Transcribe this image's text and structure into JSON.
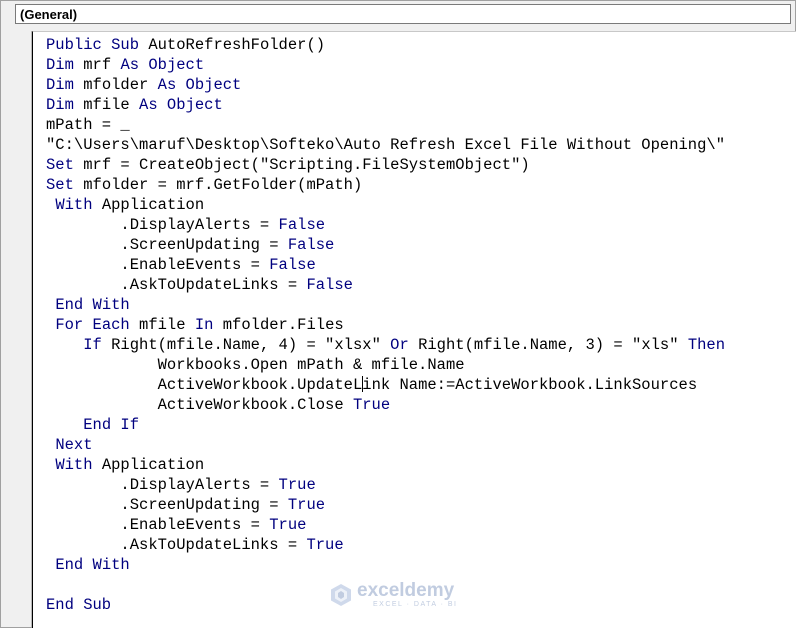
{
  "window": {
    "object_dropdown": "(General)"
  },
  "code_lines": [
    [
      {
        "k": "kw",
        "t": "Public Sub "
      },
      {
        "t": "AutoRefreshFolder()"
      }
    ],
    [
      {
        "k": "kw",
        "t": "Dim "
      },
      {
        "t": "mrf "
      },
      {
        "k": "kw",
        "t": "As Object"
      }
    ],
    [
      {
        "k": "kw",
        "t": "Dim "
      },
      {
        "t": "mfolder "
      },
      {
        "k": "kw",
        "t": "As Object"
      }
    ],
    [
      {
        "k": "kw",
        "t": "Dim "
      },
      {
        "t": "mfile "
      },
      {
        "k": "kw",
        "t": "As Object"
      }
    ],
    [
      {
        "t": "mPath = _"
      }
    ],
    [
      {
        "t": "\"C:\\Users\\maruf\\Desktop\\Softeko\\Auto Refresh Excel File Without Opening\\\""
      }
    ],
    [
      {
        "k": "kw",
        "t": "Set "
      },
      {
        "t": "mrf = CreateObject(\"Scripting.FileSystemObject\")"
      }
    ],
    [
      {
        "k": "kw",
        "t": "Set "
      },
      {
        "t": "mfolder = mrf.GetFolder(mPath)"
      }
    ],
    [
      {
        "t": " "
      },
      {
        "k": "kw",
        "t": "With "
      },
      {
        "t": "Application"
      }
    ],
    [
      {
        "t": "        .DisplayAlerts = "
      },
      {
        "k": "kw",
        "t": "False"
      }
    ],
    [
      {
        "t": "        .ScreenUpdating = "
      },
      {
        "k": "kw",
        "t": "False"
      }
    ],
    [
      {
        "t": "        .EnableEvents = "
      },
      {
        "k": "kw",
        "t": "False"
      }
    ],
    [
      {
        "t": "        .AskToUpdateLinks = "
      },
      {
        "k": "kw",
        "t": "False"
      }
    ],
    [
      {
        "t": " "
      },
      {
        "k": "kw",
        "t": "End With"
      }
    ],
    [
      {
        "t": " "
      },
      {
        "k": "kw",
        "t": "For Each "
      },
      {
        "t": "mfile "
      },
      {
        "k": "kw",
        "t": "In "
      },
      {
        "t": "mfolder.Files"
      }
    ],
    [
      {
        "t": "    "
      },
      {
        "k": "kw",
        "t": "If "
      },
      {
        "t": "Right(mfile.Name, 4) = \"xlsx\" "
      },
      {
        "k": "kw",
        "t": "Or "
      },
      {
        "t": "Right(mfile.Name, 3) = \"xls\" "
      },
      {
        "k": "kw",
        "t": "Then"
      }
    ],
    [
      {
        "t": "            Workbooks.Open mPath & mfile.Name"
      }
    ],
    [
      {
        "t": "            ActiveWorkbook.UpdateL"
      },
      {
        "k": "cursor",
        "t": ""
      },
      {
        "t": "ink Name:=ActiveWorkbook.LinkSources"
      }
    ],
    [
      {
        "t": "            ActiveWorkbook.Close "
      },
      {
        "k": "kw",
        "t": "True"
      }
    ],
    [
      {
        "t": "    "
      },
      {
        "k": "kw",
        "t": "End If"
      }
    ],
    [
      {
        "t": " "
      },
      {
        "k": "kw",
        "t": "Next"
      }
    ],
    [
      {
        "t": " "
      },
      {
        "k": "kw",
        "t": "With "
      },
      {
        "t": "Application"
      }
    ],
    [
      {
        "t": "        .DisplayAlerts = "
      },
      {
        "k": "kw",
        "t": "True"
      }
    ],
    [
      {
        "t": "        .ScreenUpdating = "
      },
      {
        "k": "kw",
        "t": "True"
      }
    ],
    [
      {
        "t": "        .EnableEvents = "
      },
      {
        "k": "kw",
        "t": "True"
      }
    ],
    [
      {
        "t": "        .AskToUpdateLinks = "
      },
      {
        "k": "kw",
        "t": "True"
      }
    ],
    [
      {
        "t": " "
      },
      {
        "k": "kw",
        "t": "End With"
      }
    ],
    [
      {
        "t": ""
      }
    ],
    [
      {
        "k": "kw",
        "t": "End Sub"
      }
    ]
  ],
  "watermark": {
    "name": "exceldemy",
    "tagline": "EXCEL · DATA · BI",
    "logo_icon": "exceldemy-logo-icon"
  },
  "colors": {
    "keyword": "#00007f",
    "text": "#000000",
    "chrome": "#f0f0f0"
  }
}
